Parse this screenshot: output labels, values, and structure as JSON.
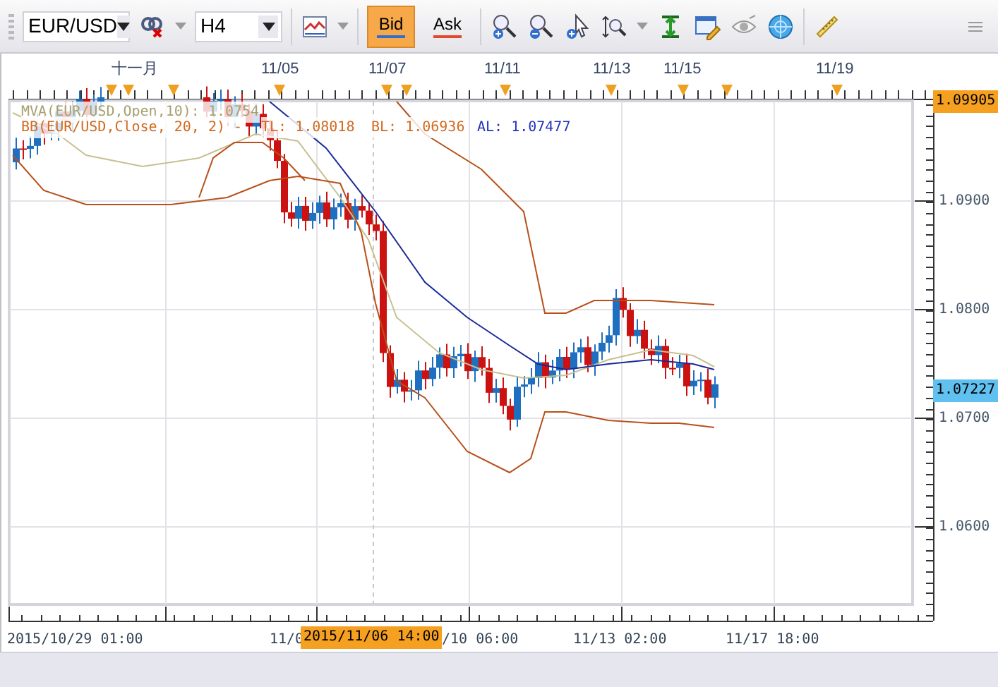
{
  "toolbar": {
    "symbol": "EUR/USD",
    "timeframe": "H4",
    "price_buttons": [
      {
        "label": "Bid",
        "selected": true
      },
      {
        "label": "Ask",
        "selected": false
      }
    ]
  },
  "top_axis": {
    "labels": [
      "十一月",
      "11/05",
      "11/07",
      "11/11",
      "11/13",
      "11/15",
      "11/19"
    ]
  },
  "legend": {
    "moving_average": "MVA(EUR/USD,Open,10): 1.0754",
    "bands": [
      {
        "text": "BB(EUR/USD,Close, 20, 2) -",
        "color": "#d2691e"
      },
      {
        "text": "TL: 1.08018",
        "color": "#d2691e"
      },
      {
        "text": "BL: 1.06936",
        "color": "#d2691e"
      },
      {
        "text": "AL: 1.07477",
        "color": "#2233bb"
      }
    ]
  },
  "price_axis": {
    "labels": [
      "1.0900",
      "1.0800",
      "1.0700",
      "1.0600"
    ],
    "high_marker": "1.09905",
    "current_price": "1.07227"
  },
  "time_axis": {
    "labels": [
      "2015/10/29 01:00",
      "11/0",
      "/10 06:00",
      "11/13 02:00",
      "11/17 18:00"
    ],
    "crosshair_time": "2015/11/06 14:00"
  }
}
